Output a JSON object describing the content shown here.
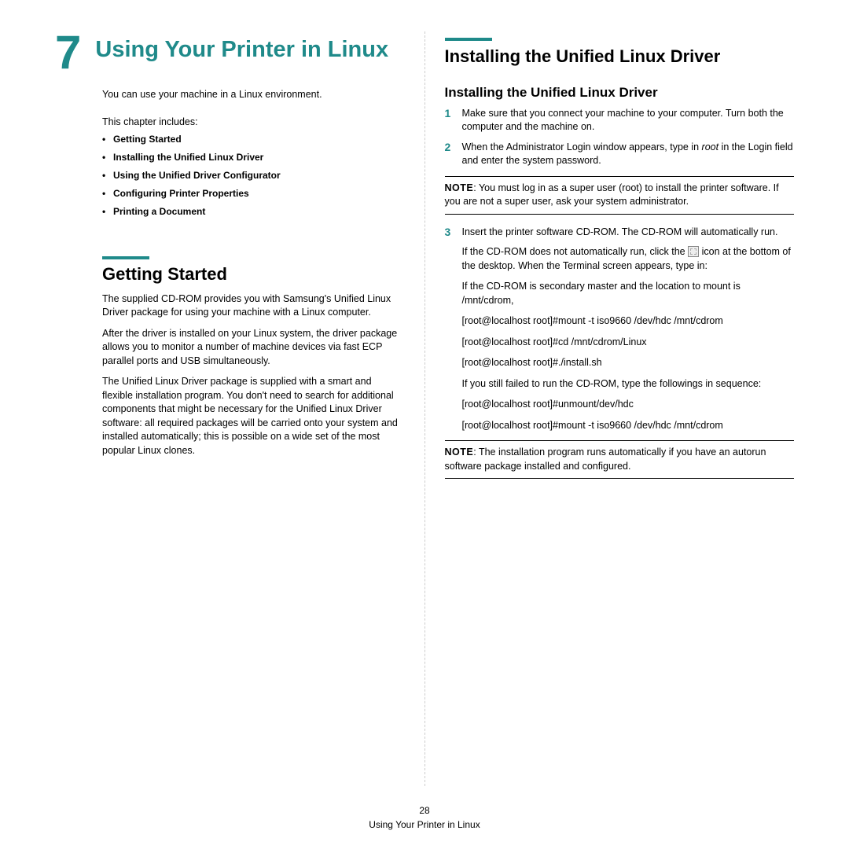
{
  "chapter": {
    "number": "7",
    "title": "Using Your Printer in Linux"
  },
  "left": {
    "intro": "You can use your machine in a Linux environment.",
    "includes_label": "This chapter includes:",
    "toc": [
      "Getting Started",
      "Installing the Unified Linux Driver",
      "Using the Unified Driver Configurator",
      "Configuring Printer Properties",
      "Printing a Document"
    ],
    "section_title": "Getting Started",
    "paras": [
      "The supplied CD-ROM provides you with Samsung's Unified Linux Driver package for using your machine with a Linux computer.",
      "After the driver is installed on your Linux system, the driver package allows you to monitor a number of machine devices via fast ECP parallel ports and USB simultaneously.",
      "The Unified Linux Driver package is supplied with a smart and flexible installation program. You don't need to search for additional components that might be necessary for the Unified Linux Driver software: all required packages will be carried onto your system and installed automatically; this is possible on a wide set of the most popular Linux clones."
    ]
  },
  "right": {
    "section_title": "Installing the Unified Linux Driver",
    "sub_title": "Installing the Unified Linux Driver",
    "steps": {
      "s1": {
        "n": "1",
        "text": "Make sure that you connect your machine to your computer. Turn both the computer and the machine on."
      },
      "s2": {
        "n": "2",
        "pre": "When the Administrator Login window appears, type in ",
        "root": "root",
        "post": " in the Login field and enter the system password."
      },
      "s3": {
        "n": "3",
        "text": "Insert the printer software CD-ROM. The CD-ROM will automatically run."
      }
    },
    "note1": {
      "label": "NOTE",
      "text": ": You must log in as a super user (root) to install the printer software. If you are not a super user, ask your system administrator."
    },
    "inset": {
      "p1a": "If the CD-ROM does not automatically run, click the ",
      "p1b": " icon at the bottom of the desktop. When the Terminal screen appears, type in:",
      "p2": "If the CD-ROM is secondary master and the location to mount is /mnt/cdrom,",
      "p3": "[root@localhost root]#mount -t iso9660 /dev/hdc /mnt/cdrom",
      "p4": "[root@localhost root]#cd /mnt/cdrom/Linux",
      "p5": "[root@localhost root]#./install.sh",
      "p6": "If you still failed to run the CD-ROM, type the followings in sequence:",
      "p7": "[root@localhost root]#unmount/dev/hdc",
      "p8": "[root@localhost root]#mount -t iso9660 /dev/hdc /mnt/cdrom"
    },
    "note2": {
      "label": "NOTE",
      "text": ": The installation program runs automatically if you have an autorun software package installed and configured."
    }
  },
  "footer": {
    "page": "28",
    "title": "Using Your Printer in Linux"
  }
}
